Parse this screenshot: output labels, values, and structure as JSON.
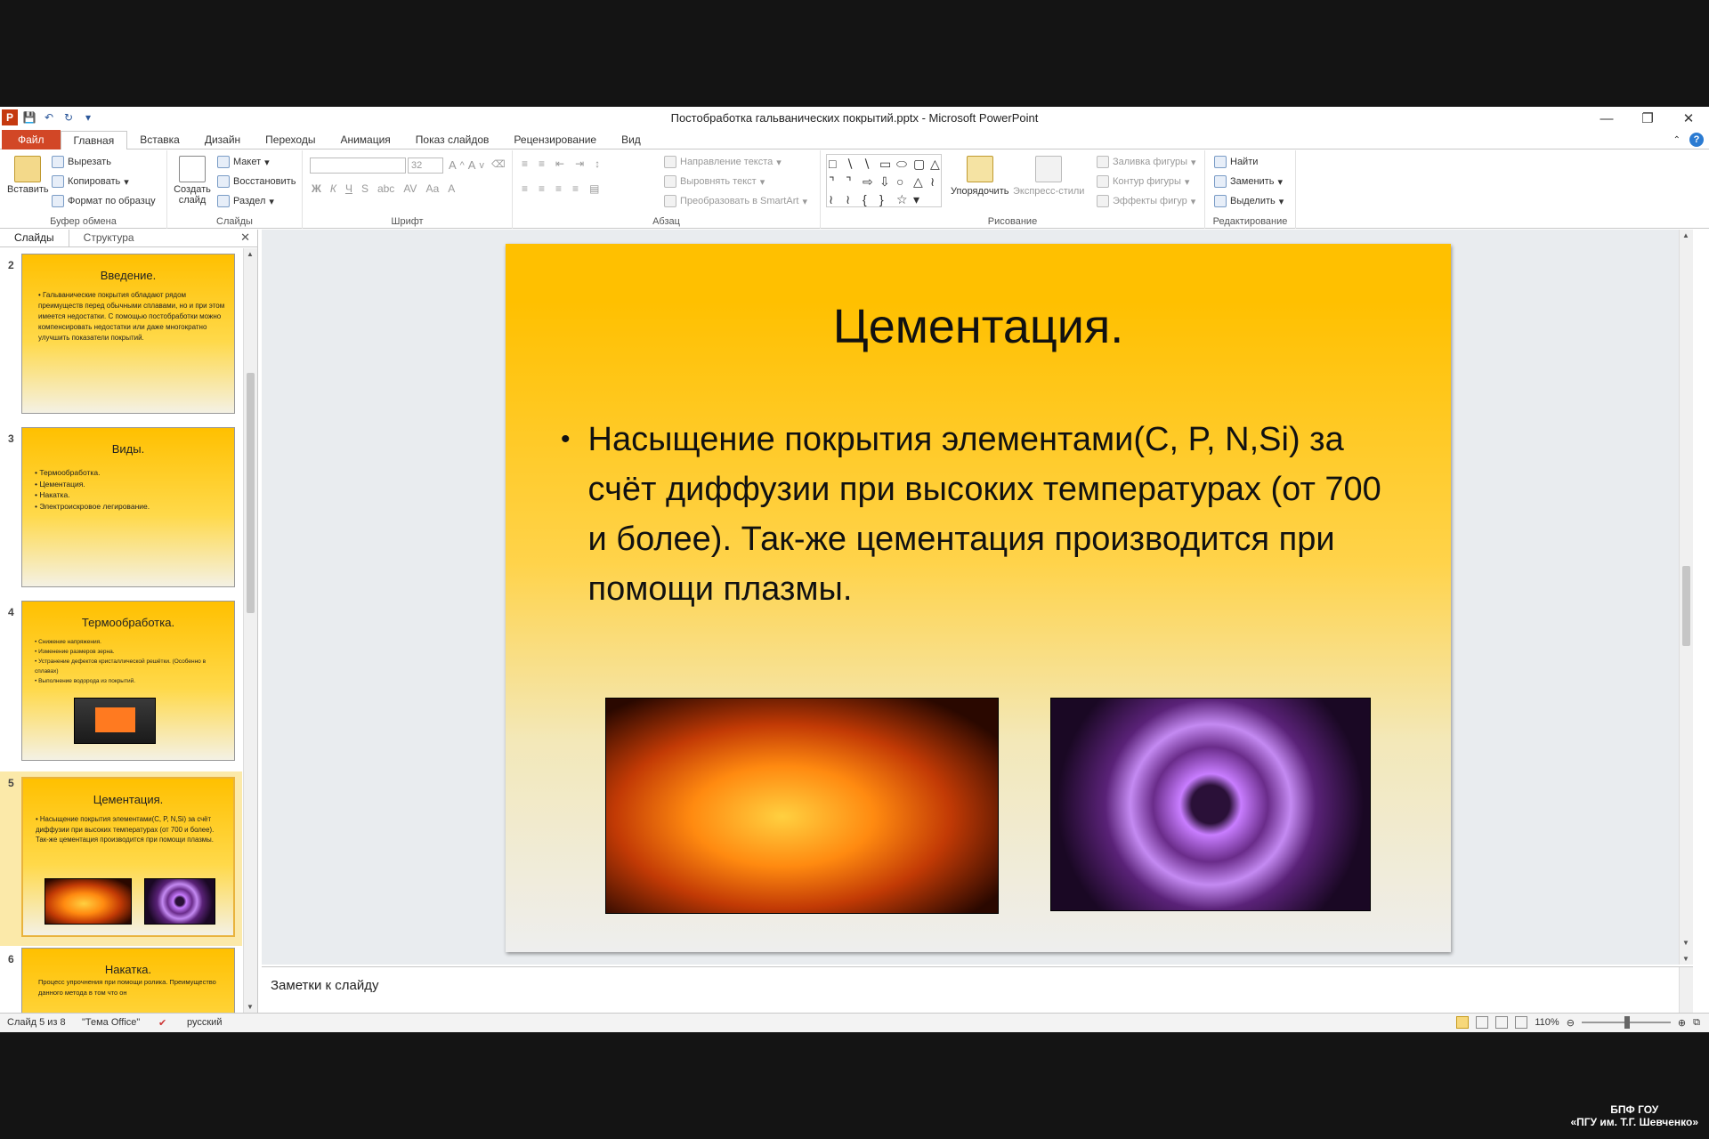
{
  "window": {
    "title": "Постобработка гальванических покрытий.pptx - Microsoft PowerPoint",
    "app_icon": "P"
  },
  "tabs": [
    "Файл",
    "Главная",
    "Вставка",
    "Дизайн",
    "Переходы",
    "Анимация",
    "Показ слайдов",
    "Рецензирование",
    "Вид"
  ],
  "ribbon": {
    "clipboard": {
      "paste": "Вставить",
      "cut": "Вырезать",
      "copy": "Копировать",
      "format_painter": "Формат по образцу",
      "label": "Буфер обмена"
    },
    "slides": {
      "new_slide": "Создать слайд",
      "layout": "Макет",
      "reset": "Восстановить",
      "section": "Раздел",
      "label": "Слайды"
    },
    "font": {
      "size": "32",
      "label": "Шрифт",
      "bold": "Ж",
      "italic": "К",
      "underline": "Ч",
      "strike": "S",
      "case": "Аа"
    },
    "paragraph": {
      "text_direction": "Направление текста",
      "align_text": "Выровнять текст",
      "smartart": "Преобразовать в SmartArt",
      "label": "Абзац"
    },
    "drawing": {
      "arrange": "Упорядочить",
      "quick_styles": "Экспресс-стили",
      "fill": "Заливка фигуры",
      "outline": "Контур фигуры",
      "effects": "Эффекты фигур",
      "label": "Рисование"
    },
    "editing": {
      "find": "Найти",
      "replace": "Заменить",
      "select": "Выделить",
      "label": "Редактирование"
    }
  },
  "panel": {
    "tab_slides": "Слайды",
    "tab_outline": "Структура"
  },
  "thumbnails": [
    {
      "num": "2",
      "title": "Введение.",
      "text": "Гальванические покрытия обладают рядом преимуществ перед обычными сплавами, но и при этом имеется недостатки. С помощью постобработки можно компенсировать недостатки или даже многократно улучшить показатели покрытий."
    },
    {
      "num": "3",
      "title": "Виды.",
      "items": [
        "Термообработка.",
        "Цементация.",
        "Накатка.",
        "Электроискровое легирование."
      ]
    },
    {
      "num": "4",
      "title": "Термообработка.",
      "items": [
        "Снижение напряжения.",
        "Изменение размеров зерна.",
        "Устранение дефектов кристаллической решётки. (Особенно в сплавах)",
        "Выполнение водорода из покрытий."
      ]
    },
    {
      "num": "5",
      "title": "Цементация.",
      "text": "Насыщение покрытия элементами(C, P, N,Si) за счёт диффузии при высоких температурах (от 700 и более). Так-же цементация производится при помощи плазмы."
    },
    {
      "num": "6",
      "title": "Накатка.",
      "text": "Процесс упрочнения при помощи ролика.  Преимущество данного метода в том что он"
    }
  ],
  "slide": {
    "title": "Цементация.",
    "body": "Насыщение покрытия элементами(C, P, N,Si) за счёт диффузии при высоких температурах (от 700 и более). Так-же цементация производится при помощи плазмы."
  },
  "notes_placeholder": "Заметки к слайду",
  "status": {
    "slide_of": "Слайд 5 из 8",
    "theme": "\"Тема Office\"",
    "language": "русский",
    "zoom": "110%"
  },
  "watermark": {
    "line1": "БПФ ГОУ",
    "line2": "«ПГУ им. Т.Г. Шевченко»"
  },
  "colors": {
    "slide_bg": "#ffc000",
    "file_tab": "#d24726",
    "accent_border": "#e9b33c"
  }
}
